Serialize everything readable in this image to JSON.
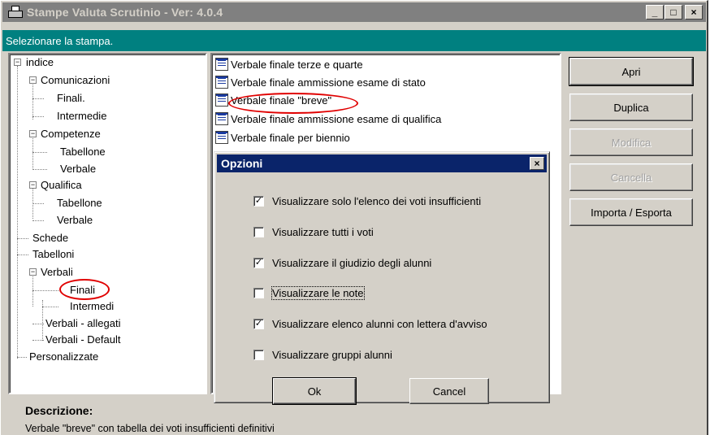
{
  "window": {
    "title": "Stampe Valuta Scrutinio - Ver: 4.0.4",
    "controls": {
      "minimize": "_",
      "maximize": "□",
      "close": "×"
    }
  },
  "banner": "Selezionare la stampa.",
  "tree": {
    "root": "indice",
    "comunicazioni": "Comunicazioni",
    "comunicazioni_finali": "Finali.",
    "comunicazioni_intermedie": "Intermedie",
    "competenze": "Competenze",
    "competenze_tabellone": "Tabellone",
    "competenze_verbale": "Verbale",
    "qualifica": "Qualifica",
    "qualifica_tabellone": "Tabellone",
    "qualifica_verbale": "Verbale",
    "schede": "Schede",
    "tabelloni": "Tabelloni",
    "verbali": "Verbali",
    "verbali_finali": "Finali",
    "verbali_intermedi": "Intermedi",
    "verbali_allegati": "Verbali - allegati",
    "verbali_default": "Verbali - Default",
    "personalizzate": "Personalizzate"
  },
  "list": {
    "items": [
      "Verbale finale terze e quarte",
      "Verbale finale ammissione esame di stato",
      "Verbale finale \"breve\"",
      "Verbale finale ammissione esame di qualifica",
      "Verbale finale per biennio"
    ]
  },
  "buttons": {
    "apri": "Apri",
    "duplica": "Duplica",
    "modifica": "Modifica",
    "cancella": "Cancella",
    "importa": "Importa / Esporta"
  },
  "description": {
    "label": "Descrizione:",
    "text": "Verbale \"breve\" con tabella dei voti insufficienti definitivi"
  },
  "dialog": {
    "title": "Opzioni",
    "close": "×",
    "options": [
      {
        "label": "Visualizzare solo l'elenco dei voti insufficienti",
        "checked": true
      },
      {
        "label": "Visualizzare tutti i voti",
        "checked": false
      },
      {
        "label": "Visualizzare il giudizio degli alunni",
        "checked": true
      },
      {
        "label": "Visualizzare le note",
        "checked": false
      },
      {
        "label": "Visualizzare elenco alunni con lettera d'avviso",
        "checked": true
      },
      {
        "label": "Visualizzare gruppi alunni",
        "checked": false
      }
    ],
    "ok": "Ok",
    "cancel": "Cancel"
  },
  "colors": {
    "banner": "#008080",
    "dialog_title": "#0a246a",
    "highlight": "#e00000",
    "face": "#d4d0c8"
  }
}
